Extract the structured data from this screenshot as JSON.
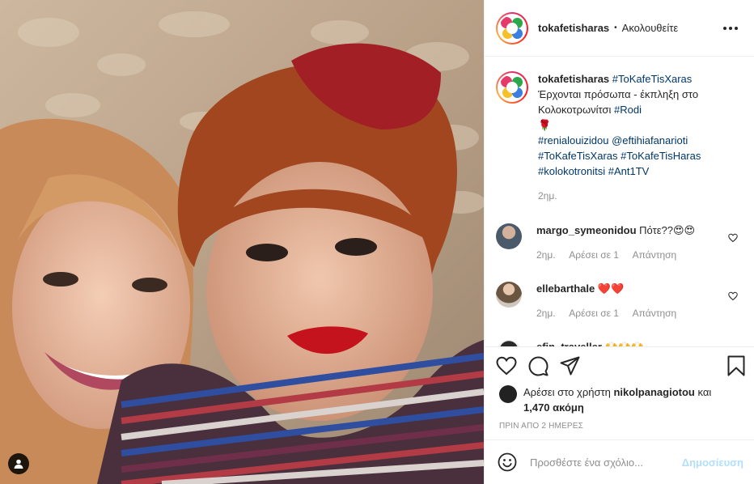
{
  "post": {
    "username": "tokafetisharas",
    "separator": "•",
    "follow_status": "Ακολουθείτε"
  },
  "caption": {
    "username": "tokafetisharas",
    "hashtag_title": "#ToKafeTisXaras",
    "text": "Έρχονται πρόσωπα - έκπληξη στο Κολοκοτρωνίτσι",
    "hashtag_rodi": "#Rodi",
    "emoji": "🌹",
    "tags_line1_a": "#renialouizidou",
    "tags_line1_b": "@eftihiafanarioti",
    "tags_line2_a": "#ToKafeTisXaras",
    "tags_line2_b": "#ToKafeTisHaras",
    "tags_line3_a": "#kolokotronitsi",
    "tags_line3_b": "#Ant1TV",
    "time": "2ημ."
  },
  "comments": [
    {
      "username": "margo_symeonidou",
      "text": "Πότε??😍😍",
      "time": "2ημ.",
      "likes": "Αρέσει σε 1",
      "reply": "Απάντηση"
    },
    {
      "username": "ellebarthale",
      "text": "❤️❤️",
      "time": "2ημ.",
      "likes": "Αρέσει σε 1",
      "reply": "Απάντηση"
    },
    {
      "username": "efin_traveller",
      "text": "🙌🙌🙌",
      "time": "",
      "likes": "",
      "reply": ""
    }
  ],
  "likes": {
    "prefix": "Αρέσει στο χρήστη",
    "user": "nikolpanagiotou",
    "middle": "και",
    "count": "1,470 ακόμη"
  },
  "date": "ΠΡΙΝ ΑΠΟ 2 ΗΜΕΡΕΣ",
  "add_comment": {
    "placeholder": "Προσθέστε ένα σχόλιο...",
    "post_label": "Δημοσίευση"
  },
  "icons": [
    "heart-icon",
    "comment-icon",
    "share-icon",
    "bookmark-icon",
    "emoji-icon",
    "user-tag-icon",
    "more-icon"
  ],
  "colors": {
    "link": "#00376b",
    "muted": "#8e8e8e",
    "post_disabled": "#b2dffc",
    "like_red": "#ed4956"
  }
}
